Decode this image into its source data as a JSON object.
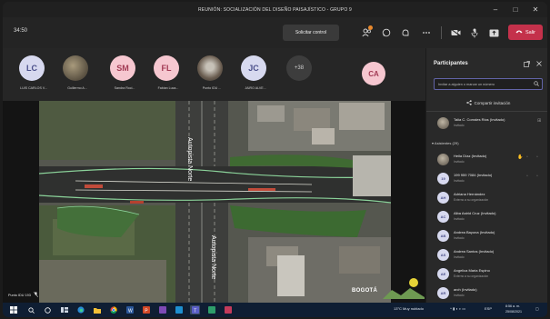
{
  "window": {
    "title": "REUNIÓN: SOCIALIZACIÓN DEL DISEÑO PAISAJÍSTICO - GRUPO 9",
    "minimize": "–",
    "maximize": "□",
    "close": "✕"
  },
  "toolbar": {
    "timer": "34:50",
    "request_control": "Solicitar control",
    "leave_label": "Salir",
    "icons": [
      "participants-icon",
      "chat-icon",
      "reactions-icon",
      "more-icon",
      "camera-icon",
      "microphone-icon",
      "share-icon",
      "leave-phone-icon"
    ],
    "colors": {
      "leave": "#c4314b",
      "notification": "#e9892d"
    }
  },
  "strip": {
    "participants": [
      {
        "initials": "LC",
        "name": "LUIS CARLOS V...",
        "kind": "initials"
      },
      {
        "initials": "",
        "name": "Guillermo A...",
        "kind": "photo"
      },
      {
        "initials": "SM",
        "name": "Sandra Roci...",
        "kind": "initials-pink"
      },
      {
        "initials": "FL",
        "name": "Fabian Luca...",
        "kind": "initials-pink"
      },
      {
        "initials": "",
        "name": "Punto IDU ...",
        "kind": "photo2"
      },
      {
        "initials": "JC",
        "name": "JAIRO ALVE...",
        "kind": "initials"
      },
      {
        "initials": "+38",
        "name": "",
        "kind": "more"
      }
    ],
    "self_initials": "CA"
  },
  "stage": {
    "presenter_label": "Punto IDU 193",
    "logo_text": "BOGOTÁ",
    "map_labels": [
      "Autopista Norte",
      "Autopista Norte"
    ]
  },
  "panel": {
    "title": "Participantes",
    "search_placeholder": "Invitar a alguien o marcar un número",
    "invite_label": "Compartir invitación",
    "invited": [
      {
        "name": "Talia C. Corrales Rios (Invitado)",
        "sub": "Invitado",
        "initials": "TC"
      }
    ],
    "attendees_header": "Asistentes (29)",
    "attendees": [
      {
        "name": "Heila Díaz (Invitado)",
        "sub": "Invitado",
        "initials": "HD"
      },
      {
        "name": "199 959 7084 (Invitado)",
        "sub": "Invitado",
        "initials": "19"
      },
      {
        "name": "Adriana Hernández",
        "sub": "Externo a su organización",
        "initials": "AH"
      },
      {
        "name": "Alba Astrid Cruz (Invitado)",
        "sub": "Invitado",
        "initials": "AC"
      },
      {
        "name": "Andrea Bayona (Invitado)",
        "sub": "Invitado",
        "initials": "AB"
      },
      {
        "name": "Andrea Santos (Invitado)",
        "sub": "Invitado",
        "initials": "AS"
      },
      {
        "name": "Angelica Maria Espino",
        "sub": "Externo a su organización",
        "initials": "AE"
      },
      {
        "name": "arch (Invitado)",
        "sub": "Invitado",
        "initials": "AR"
      }
    ]
  },
  "taskbar": {
    "weather": "13°C Muy nublado",
    "language": "ESP",
    "time": "8:56 a. m.",
    "date": "25/08/2021"
  }
}
